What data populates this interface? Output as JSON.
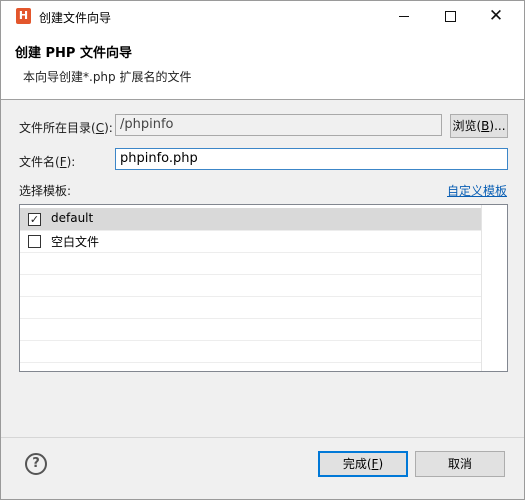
{
  "window": {
    "title": "创建文件向导",
    "app_icon_letter": "H"
  },
  "header": {
    "title": "创建 PHP 文件向导",
    "description": "本向导创建*.php 扩展名的文件"
  },
  "form": {
    "dir_label_prefix": "文件所在目录(",
    "dir_label_key": "C",
    "dir_label_suffix": "):",
    "dir_value": "/phpinfo",
    "browse_prefix": "浏览(",
    "browse_key": "B",
    "browse_suffix": ")...",
    "name_label_prefix": "文件名(",
    "name_label_key": "F",
    "name_label_suffix": "):",
    "name_value": "phpinfo.php",
    "template_label": "选择模板:",
    "custom_template_link": "自定义模板"
  },
  "templates": [
    {
      "label": "default",
      "checked": true
    },
    {
      "label": "空白文件",
      "checked": false
    }
  ],
  "footer": {
    "help_glyph": "?",
    "finish_prefix": "完成(",
    "finish_key": "F",
    "finish_suffix": ")",
    "cancel_label": "取消"
  }
}
